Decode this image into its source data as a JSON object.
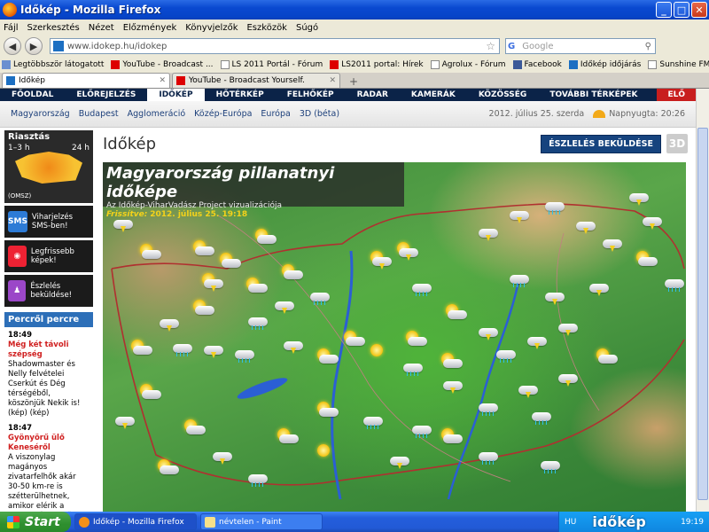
{
  "window": {
    "title": "Időkép - Mozilla Firefox",
    "min": "_",
    "max": "□",
    "close": "✕"
  },
  "menu": [
    "Fájl",
    "Szerkesztés",
    "Nézet",
    "Előzmények",
    "Könyvjelzők",
    "Eszközök",
    "Súgó"
  ],
  "nav": {
    "back": "◀",
    "forward": "▶",
    "url": "www.idokep.hu/idokep",
    "search_engine": "G",
    "search_placeholder": "Google",
    "search_icon": "magnifier"
  },
  "bookmarks": [
    "Legtöbbször látogatott",
    "YouTube - Broadcast ...",
    "LS 2011 Portál - Fórum",
    "LS2011 portal: Hírek",
    "Agrolux - Fórum",
    "Facebook",
    "Időkép időjárás",
    "Sunshine FM Player"
  ],
  "tabs": [
    {
      "label": "Időkép",
      "close": "✕"
    },
    {
      "label": "YouTube - Broadcast Yourself.",
      "close": "✕"
    }
  ],
  "new_tab": "+",
  "site": {
    "nav": [
      "FŐOLDAL",
      "ELŐREJELZÉS",
      "IDŐKÉP",
      "HŐTÉRKÉP",
      "FELHŐKÉP",
      "RADAR",
      "KAMERÁK",
      "KÖZÖSSÉG",
      "TOVÁBBI TÉRKÉPEK"
    ],
    "login": "ELŐ",
    "subnav": [
      "Magyarország",
      "Budapest",
      "Agglomeráció",
      "Közép-Európa",
      "Európa",
      "3D (béta)"
    ],
    "date": "2012. július 25. szerda",
    "sunset": "Napnyugta: 20:26"
  },
  "sidebar": {
    "alert_title": "Riasztás",
    "alert_from": "1–3 h",
    "alert_to": "24 h",
    "alert_source": "(OMSZ)",
    "buttons": [
      {
        "icon": "SMS",
        "label": "Viharjelzés SMS-ben!"
      },
      {
        "icon": "cam",
        "label": "Legfrissebb képek!"
      },
      {
        "icon": "upload",
        "label": "Észlelés beküldése!"
      }
    ],
    "feed_title": "Percről percre",
    "news": [
      {
        "time": "18:49",
        "head": "Még két távoli szépség",
        "body": "Shadowmaster és Nelly felvételei Cserkút és Dég térségéből, köszönjük Nekik is! (kép) (kép)"
      },
      {
        "time": "18:47",
        "head": "Gyönyörű ülő Keneséről",
        "body": "A viszonylag magányos zivatarfelhők akár 30-50 km-re is szétterülhetnek, amikor elérik a troposzféra felső határát, így"
      }
    ]
  },
  "main": {
    "heading": "Időkép",
    "submit_button": "ÉSZLELÉS BEKÜLDÉSE",
    "btn_3d": "3D",
    "map_title": "Magyarország pillanatnyi időképe",
    "map_subtitle": "Az Időkép-ViharVadász Project vizualizációja",
    "updated_label": "Frissítve:",
    "updated_value": "2012. július 25. 19:18"
  },
  "taskbar": {
    "start": "Start",
    "tasks": [
      "Időkép - Mozilla Firefox",
      "névtelen - Paint"
    ],
    "lang": "HU",
    "logo": "időkép",
    "clock": "19:19"
  }
}
